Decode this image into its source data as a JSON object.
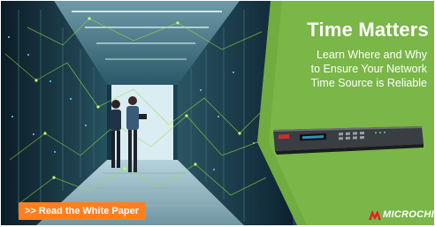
{
  "headline": "Time Matters",
  "subtext": {
    "line1": "Learn Where and Why",
    "line2": "to Ensure Your Network",
    "line3": "Time Source is Reliable"
  },
  "cta": {
    "label": ">> Read the White Paper"
  },
  "brand": {
    "name": "MICROCHIP",
    "logo_icon": "microchip-logo-icon"
  },
  "colors": {
    "panel_green": "#7ab648",
    "cta_orange": "#ff7f1f",
    "datacenter_dark": "#0b2a3a",
    "network_glow": "#9be03a"
  }
}
